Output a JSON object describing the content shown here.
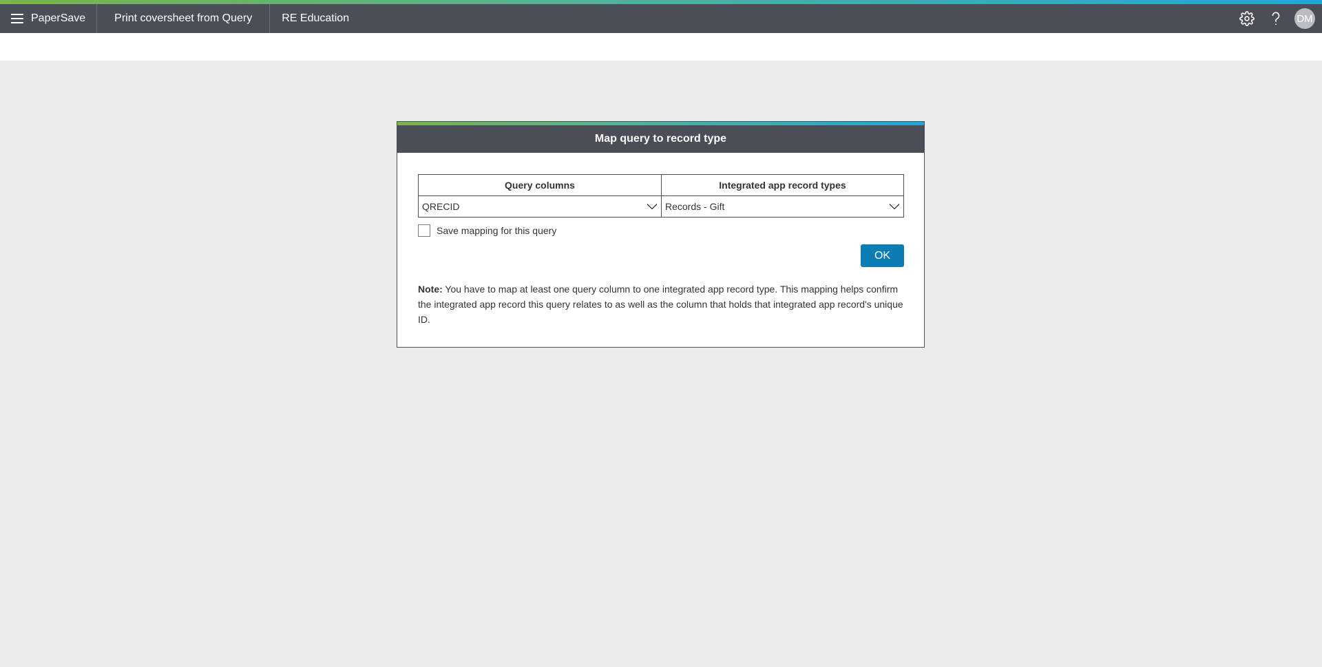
{
  "topbar": {
    "brand": "PaperSave",
    "nav": [
      "Print coversheet from Query",
      "RE Education"
    ],
    "user_initials": "DM",
    "icons": {
      "menu": "hamburger-menu-icon",
      "settings": "gear-icon",
      "help": "help-icon"
    }
  },
  "dialog": {
    "title": "Map query to record type",
    "columns": {
      "query": "Query columns",
      "record_types": "Integrated app record types"
    },
    "row": {
      "query_value": "QRECID",
      "record_value": "Records - Gift"
    },
    "save_label": "Save mapping for this query",
    "save_checked": false,
    "ok_label": "OK",
    "note_label": "Note:",
    "note_text": "You have to map at least one query column to one integrated app record type. This mapping helps confirm the integrated app record this query relates to as well as the column that holds that integrated app record's unique ID."
  },
  "colors": {
    "topbar_bg": "#4a4e56",
    "accent_green": "#7ab648",
    "accent_blue": "#1ea7d9",
    "primary_button": "#0b7db5",
    "page_bg": "#ececec"
  }
}
